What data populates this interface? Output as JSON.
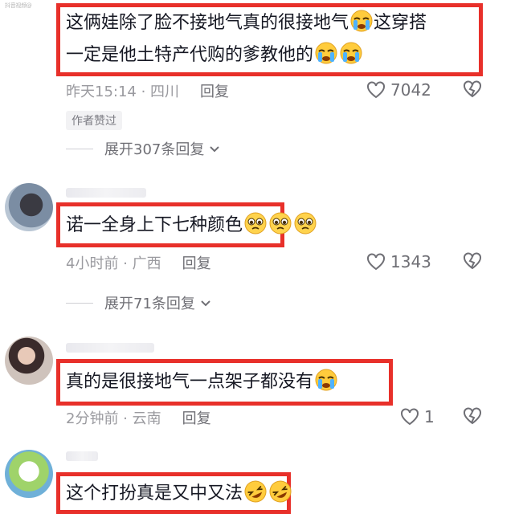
{
  "corner_label": "抖音视频@",
  "comments": [
    {
      "text_line1": "这俩娃除了脸不接地气真的很接地气",
      "text_line1_end": "这穿搭",
      "text_line2": "一定是他土特产代购的爹教他的",
      "meta_time": "昨天15:14 · 四川",
      "reply_label": "回复",
      "like_count": "7042",
      "author_tag": "作者赞过",
      "expand_label": "展开307条回复",
      "emoji": [
        "crying-face",
        "crying-face",
        "crying-face"
      ]
    },
    {
      "text": "诺一全身上下七种颜色",
      "meta_time": "4小时前 · 广西",
      "reply_label": "回复",
      "like_count": "1343",
      "expand_label": "展开71条回复",
      "emoji": [
        "pleading-face",
        "pleading-face",
        "pleading-face"
      ]
    },
    {
      "text": "真的是很接地气一点架子都没有",
      "meta_time": "2分钟前 · 云南",
      "reply_label": "回复",
      "like_count": "1",
      "emoji": [
        "crying-face"
      ]
    },
    {
      "text": "这个打扮真是又中又法",
      "emoji": [
        "rolling-laughing-face",
        "rolling-laughing-face"
      ]
    }
  ],
  "colors": {
    "highlight": "#e8302a",
    "text": "#161823",
    "meta": "#9a9a9f"
  }
}
